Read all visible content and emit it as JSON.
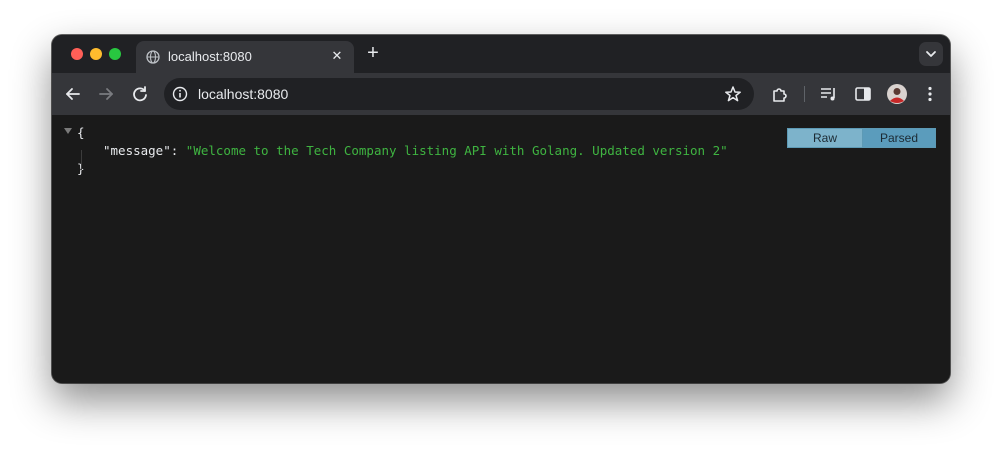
{
  "browser": {
    "tab": {
      "title": "localhost:8080",
      "favicon": "globe-icon"
    },
    "address_bar": {
      "url": "localhost:8080"
    },
    "icons": {
      "back": "arrow-left-icon",
      "forward": "arrow-right-icon",
      "reload": "reload-icon",
      "site_info": "info-icon",
      "bookmark": "star-icon",
      "extensions": "puzzle-icon",
      "media": "media-playlist-icon",
      "side_panel": "side-panel-icon",
      "profile": "avatar",
      "menu": "kebab-menu-icon",
      "tab_search": "chevron-down-icon",
      "new_tab": "plus-icon",
      "close_tab": "close-icon"
    }
  },
  "json_viewer": {
    "open_brace": "{",
    "close_brace": "}",
    "key": "\"message\"",
    "separator": ": ",
    "value": "\"Welcome to the Tech Company listing API with Golang. Updated version 2\"",
    "buttons": {
      "raw": "Raw",
      "parsed": "Parsed"
    }
  },
  "colors": {
    "string_value": "#3fb441",
    "toggle_raw": "#7db3cb",
    "toggle_parsed": "#5b9cbc",
    "page_background": "#1a1a1a"
  }
}
